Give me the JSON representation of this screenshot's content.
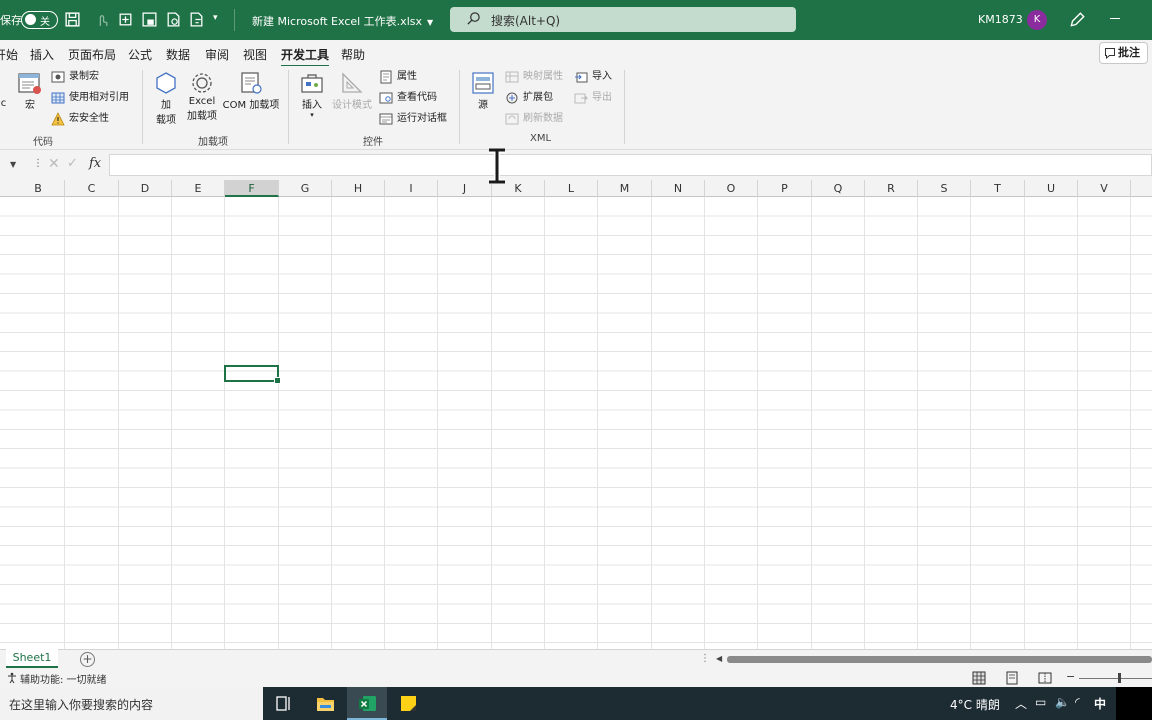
{
  "titlebar": {
    "autosave_label": "保存",
    "autosave_state": "关",
    "filename": "新建 Microsoft Excel 工作表.xlsx",
    "search_placeholder": "搜索(Alt+Q)",
    "username": "KM1873",
    "avatar_initial": "K",
    "accent_color": "#1f7246"
  },
  "tabs": [
    {
      "label": "开始",
      "active": false
    },
    {
      "label": "插入",
      "active": false
    },
    {
      "label": "页面布局",
      "active": false
    },
    {
      "label": "公式",
      "active": false
    },
    {
      "label": "数据",
      "active": false
    },
    {
      "label": "审阅",
      "active": false
    },
    {
      "label": "视图",
      "active": false
    },
    {
      "label": "开发工具",
      "active": true
    },
    {
      "label": "帮助",
      "active": false
    }
  ],
  "comment_button": "批注",
  "ribbon": {
    "code": {
      "group_label": "代码",
      "vb_label": "ic",
      "macro_label": "宏",
      "record_macro": "录制宏",
      "relative_ref": "使用相对引用",
      "macro_security": "宏安全性"
    },
    "addins": {
      "group_label": "加载项",
      "addins_line1": "加",
      "addins_line2": "载项",
      "excel_addins_line1": "Excel",
      "excel_addins_line2": "加载项",
      "com_addins": "COM 加载项"
    },
    "controls": {
      "group_label": "控件",
      "insert": "插入",
      "design_mode": "设计模式",
      "properties": "属性",
      "view_code": "查看代码",
      "run_dialog": "运行对话框"
    },
    "xml": {
      "group_label": "XML",
      "source": "源",
      "map_properties": "映射属性",
      "expansion_packs": "扩展包",
      "refresh_data": "刷新数据",
      "import": "导入",
      "export": "导出"
    }
  },
  "columns": [
    "B",
    "C",
    "D",
    "E",
    "F",
    "G",
    "H",
    "I",
    "J",
    "K",
    "L",
    "M",
    "N",
    "O",
    "P",
    "Q",
    "R",
    "S",
    "T",
    "U",
    "V"
  ],
  "selected_column": "F",
  "sheets": [
    "Sheet1"
  ],
  "status": {
    "accessibility": "辅助功能: 一切就绪"
  },
  "taskbar": {
    "search_placeholder": "在这里输入你要搜索的内容",
    "weather": "4°C  晴朗",
    "ime": "中"
  }
}
